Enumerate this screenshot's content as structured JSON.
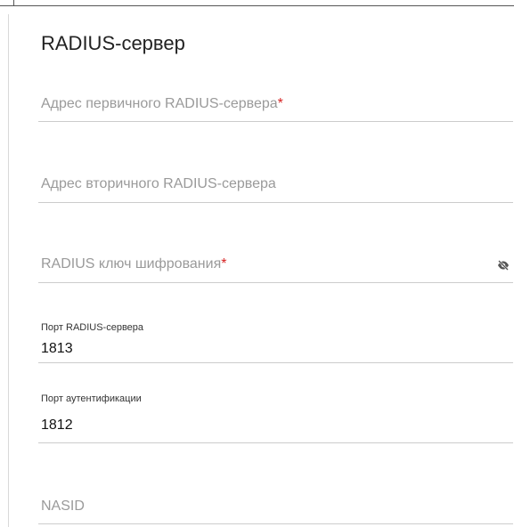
{
  "section": {
    "title": "RADIUS-сервер"
  },
  "fields": {
    "primary_address": {
      "placeholder": "Адрес первичного RADIUS-сервера",
      "required_mark": "*"
    },
    "secondary_address": {
      "placeholder": "Адрес вторичного RADIUS-сервера"
    },
    "encryption_key": {
      "placeholder": "RADIUS ключ шифрования",
      "required_mark": "*",
      "toggle_icon": "eye-off-icon"
    },
    "server_port": {
      "label": "Порт RADIUS-сервера",
      "value": "1813"
    },
    "auth_port": {
      "label": "Порт аутентификации",
      "value": "1812"
    },
    "nasid": {
      "placeholder": "NASID"
    }
  },
  "colors": {
    "required": "#d62222",
    "placeholder": "#9a9a9a",
    "underline": "#cccccc"
  }
}
